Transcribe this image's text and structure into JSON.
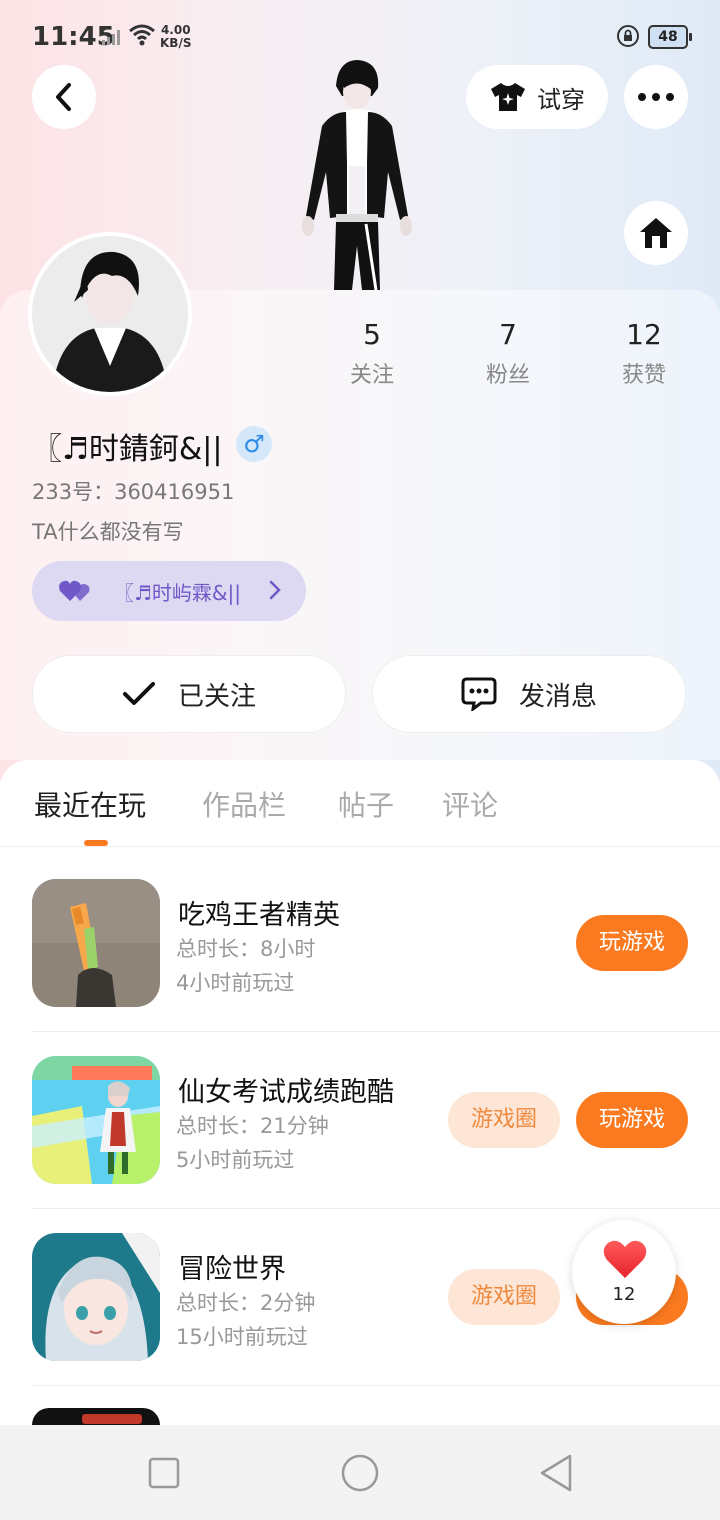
{
  "status_bar": {
    "time": "11:45",
    "net_speed_value": "4.00",
    "net_speed_unit": "KB/S",
    "battery": "48"
  },
  "header": {
    "try_on_label": "试穿",
    "back_icon": "chevron-left-icon",
    "more_icon": "more-icon",
    "home_icon": "home-icon",
    "shirt_icon": "shirt-sparkle-icon"
  },
  "profile": {
    "stats": [
      {
        "value": "5",
        "label": "关注"
      },
      {
        "value": "7",
        "label": "粉丝"
      },
      {
        "value": "12",
        "label": "获赞"
      }
    ],
    "username": "〖♬时錆鈳&||",
    "gender_symbol": "♂",
    "uid": "233号：360416951",
    "bio": "TA什么都没有写",
    "couple_name": "〖♬时屿霖&||"
  },
  "actions": {
    "follow_label": "已关注",
    "message_label": "发消息"
  },
  "tabs": [
    {
      "label": "最近在玩"
    },
    {
      "label": "作品栏"
    },
    {
      "label": "帖子"
    },
    {
      "label": "评论"
    }
  ],
  "games": [
    {
      "name": "吃鸡王者精英",
      "duration": "总时长：8小时",
      "last_played": "4小时前玩过",
      "play_label": "玩游戏"
    },
    {
      "name": "仙女考试成绩跑酷",
      "duration": "总时长：21分钟",
      "last_played": "5小时前玩过",
      "circle_label": "游戏圈",
      "play_label": "玩游戏"
    },
    {
      "name": "冒险世界",
      "duration": "总时长：2分钟",
      "last_played": "15小时前玩过",
      "circle_label": "游戏圈",
      "play_label": "玩游戏"
    }
  ],
  "floating_like": {
    "count": "12"
  },
  "colors": {
    "accent": "#fb7a1f",
    "accent_soft": "#fde6d6",
    "couple_bg": "#ddd9f2",
    "couple_text": "#7058c8",
    "gender_blue": "#2d8bea"
  }
}
